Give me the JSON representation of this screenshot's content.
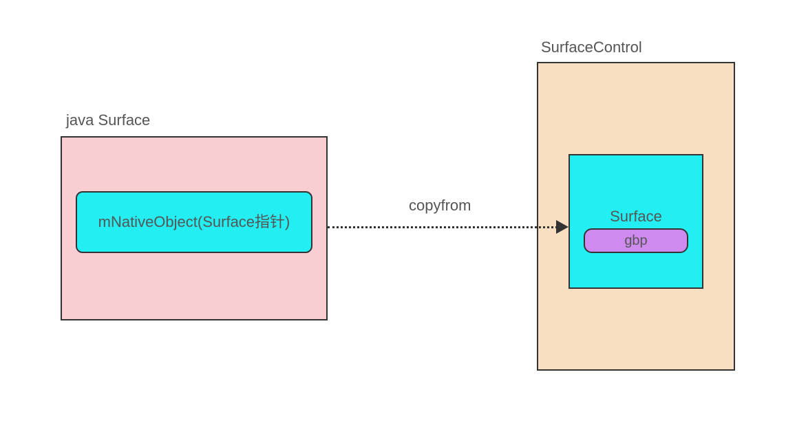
{
  "left": {
    "title": "java Surface",
    "inner_label": "mNativeObject(Surface指针)"
  },
  "right": {
    "title": "SurfaceControl",
    "surface_label": "Surface",
    "gbp_label": "gbp"
  },
  "arrow": {
    "label": "copyfrom"
  },
  "styles": {
    "java_surface_bg": "#f9ced3",
    "surface_control_bg": "#f9dfc1",
    "cyan": "#23eff3",
    "purple": "#cf8af0",
    "border": "#333333"
  }
}
